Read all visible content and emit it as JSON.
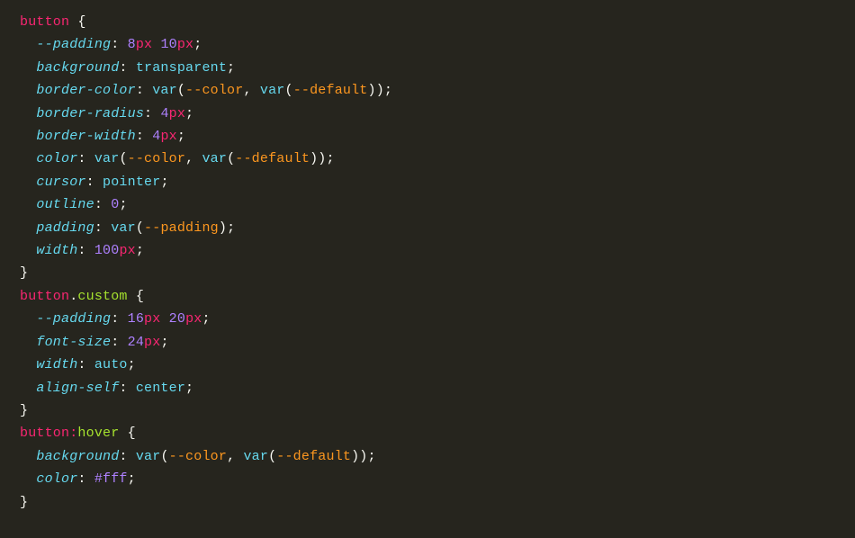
{
  "code": {
    "rules": [
      {
        "selector_parts": [
          "button"
        ],
        "declarations": [
          {
            "prop": "--padding",
            "value_tokens": [
              [
                "num",
                "8"
              ],
              [
                "unit",
                "px"
              ],
              [
                "sp",
                " "
              ],
              [
                "num",
                "10"
              ],
              [
                "unit",
                "px"
              ]
            ]
          },
          {
            "prop": "background",
            "value_tokens": [
              [
                "kw",
                "transparent"
              ]
            ]
          },
          {
            "prop": "border-color",
            "value_tokens": [
              [
                "kw",
                "var"
              ],
              [
                "punc",
                "("
              ],
              [
                "var",
                "--color"
              ],
              [
                "punc",
                ", "
              ],
              [
                "kw",
                "var"
              ],
              [
                "punc",
                "("
              ],
              [
                "var",
                "--default"
              ],
              [
                "punc",
                "))"
              ]
            ]
          },
          {
            "prop": "border-radius",
            "value_tokens": [
              [
                "num",
                "4"
              ],
              [
                "unit",
                "px"
              ]
            ]
          },
          {
            "prop": "border-width",
            "value_tokens": [
              [
                "num",
                "4"
              ],
              [
                "unit",
                "px"
              ]
            ]
          },
          {
            "prop": "color",
            "value_tokens": [
              [
                "kw",
                "var"
              ],
              [
                "punc",
                "("
              ],
              [
                "var",
                "--color"
              ],
              [
                "punc",
                ", "
              ],
              [
                "kw",
                "var"
              ],
              [
                "punc",
                "("
              ],
              [
                "var",
                "--default"
              ],
              [
                "punc",
                "))"
              ]
            ]
          },
          {
            "prop": "cursor",
            "value_tokens": [
              [
                "kw",
                "pointer"
              ]
            ]
          },
          {
            "prop": "outline",
            "value_tokens": [
              [
                "num",
                "0"
              ]
            ]
          },
          {
            "prop": "padding",
            "value_tokens": [
              [
                "kw",
                "var"
              ],
              [
                "punc",
                "("
              ],
              [
                "var",
                "--padding"
              ],
              [
                "punc",
                ")"
              ]
            ]
          },
          {
            "prop": "width",
            "value_tokens": [
              [
                "num",
                "100"
              ],
              [
                "unit",
                "px"
              ]
            ]
          }
        ]
      },
      {
        "selector_parts": [
          "button",
          ".",
          "custom"
        ],
        "declarations": [
          {
            "prop": "--padding",
            "value_tokens": [
              [
                "num",
                "16"
              ],
              [
                "unit",
                "px"
              ],
              [
                "sp",
                " "
              ],
              [
                "num",
                "20"
              ],
              [
                "unit",
                "px"
              ]
            ]
          },
          {
            "prop": "font-size",
            "value_tokens": [
              [
                "num",
                "24"
              ],
              [
                "unit",
                "px"
              ]
            ]
          },
          {
            "prop": "width",
            "value_tokens": [
              [
                "kw",
                "auto"
              ]
            ]
          },
          {
            "prop": "align-self",
            "value_tokens": [
              [
                "kw",
                "center"
              ]
            ]
          }
        ]
      },
      {
        "selector_parts": [
          "button",
          ":",
          "hover"
        ],
        "declarations": [
          {
            "prop": "background",
            "value_tokens": [
              [
                "kw",
                "var"
              ],
              [
                "punc",
                "("
              ],
              [
                "var",
                "--color"
              ],
              [
                "punc",
                ", "
              ],
              [
                "kw",
                "var"
              ],
              [
                "punc",
                "("
              ],
              [
                "var",
                "--default"
              ],
              [
                "punc",
                "))"
              ]
            ]
          },
          {
            "prop": "color",
            "value_tokens": [
              [
                "hex",
                "#fff"
              ]
            ]
          }
        ]
      }
    ]
  }
}
